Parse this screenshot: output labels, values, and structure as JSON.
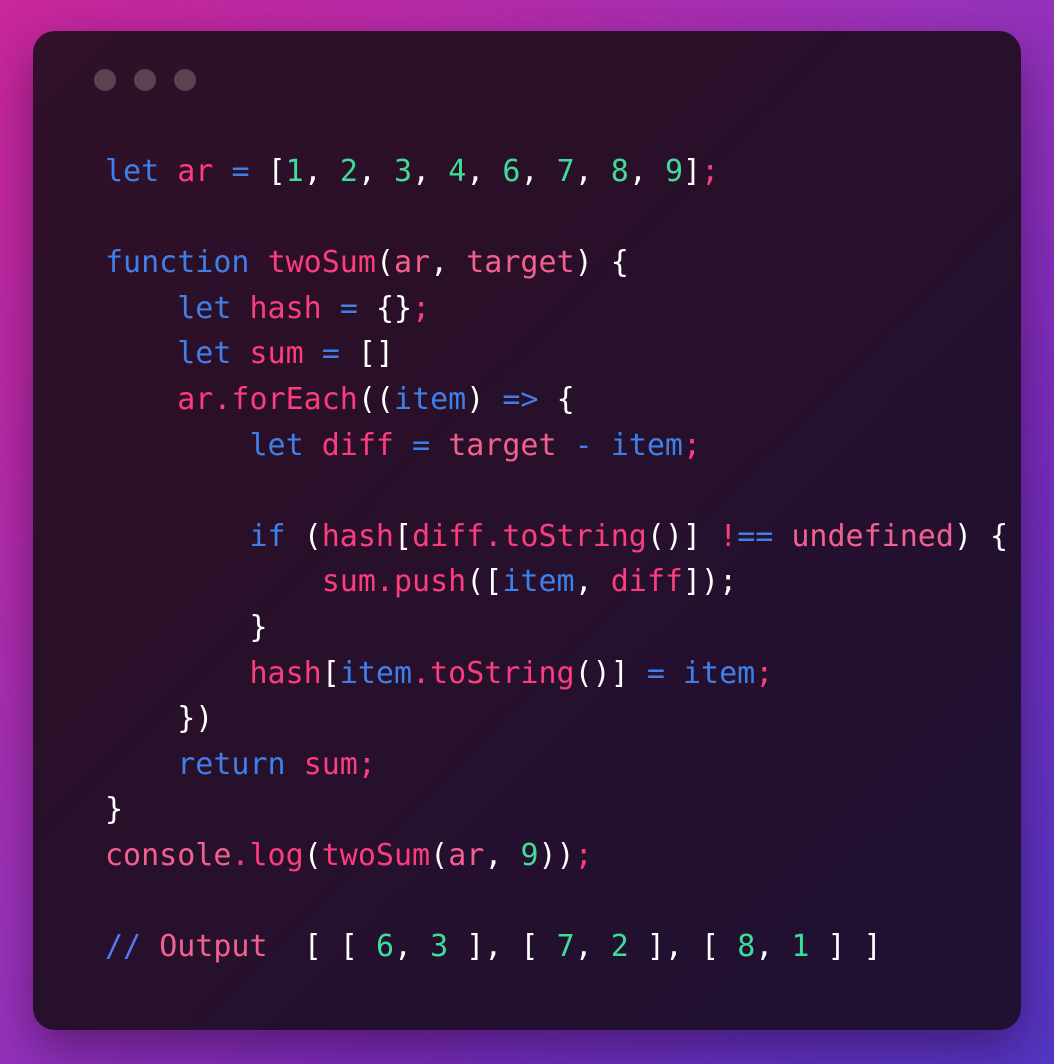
{
  "window": {
    "traffic_lights": [
      "dot-1",
      "dot-2",
      "dot-3"
    ],
    "background_gradient": {
      "top_left": "#c9269a",
      "top_right": "#9a33bb",
      "bottom_left": "#7b2cba",
      "bottom_right": "#5436c4"
    },
    "card_gradient": {
      "start": "#30102a",
      "end": "#1e1134"
    },
    "dot_color": "#5c4352"
  },
  "syntax_colors": {
    "keyword": "#3f7fe8",
    "identifier": "#fb3d7e",
    "soft_identifier": "#f2608f",
    "number": "#3ddc97",
    "punctuation": "#ffffff",
    "comment_slash": "#5478f0",
    "comment_text": "#f2608f"
  },
  "code": {
    "language": "javascript",
    "lines": [
      "let ar = [1, 2, 3, 4, 6, 7, 8, 9];",
      "",
      "function twoSum(ar, target) {",
      "    let hash = {};",
      "    let sum = []",
      "    ar.forEach((item) => {",
      "        let diff = target - item;",
      "",
      "        if (hash[diff.toString()] !== undefined) {",
      "            sum.push([item, diff]);",
      "        }",
      "        hash[item.toString()] = item;",
      "    })",
      "    return sum;",
      "}",
      "console.log(twoSum(ar, 9));",
      "",
      "// Output  [ [ 6, 3 ], [ 7, 2 ], [ 8, 1 ] ]"
    ],
    "array_values": [
      1,
      2,
      3,
      4,
      6,
      7,
      8,
      9
    ],
    "function_name": "twoSum",
    "function_params": [
      "ar",
      "target"
    ],
    "target_argument": 9,
    "output_comment_label": "// Output",
    "output_pairs": [
      [
        6,
        3
      ],
      [
        7,
        2
      ],
      [
        8,
        1
      ]
    ]
  }
}
